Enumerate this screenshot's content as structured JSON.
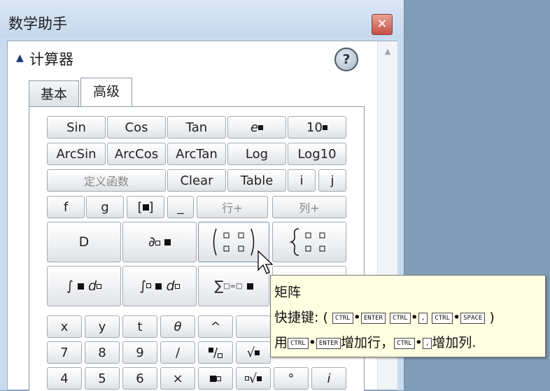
{
  "window": {
    "title": "数学助手",
    "close_glyph": "✕"
  },
  "section": {
    "title": "计算器",
    "help_label": "?"
  },
  "tabs": [
    {
      "label": "基本"
    },
    {
      "label": "高级"
    }
  ],
  "buttons": {
    "sin": "Sin",
    "cos": "Cos",
    "tan": "Tan",
    "e": "e",
    "ten": "10",
    "arcsin": "ArcSin",
    "arccos": "ArcCos",
    "arctan": "ArcTan",
    "log": "Log",
    "log10": "Log10",
    "define_function": "定义函数",
    "clear": "Clear",
    "table": "Table",
    "i": "i",
    "j": "j",
    "f": "f",
    "g": "g",
    "underscore": "_",
    "add_row": "行+",
    "add_col": "列+",
    "d": "D",
    "x": "x",
    "y": "y",
    "t": "t",
    "theta": "θ",
    "caret": "^",
    "seven": "7",
    "eight": "8",
    "nine": "9",
    "divide": "/",
    "four": "4",
    "five": "5",
    "six": "6",
    "times": "×",
    "degree": "°",
    "imag": "i"
  },
  "tooltip": {
    "title": "矩阵",
    "shortcut_label": "快捷键:",
    "open_paren": "(",
    "close_paren": ")",
    "line3_prefix": "用",
    "line3_add_row": "增加行，",
    "line3_add_col": "增加列.",
    "keys": {
      "ctrl": "CTRL",
      "enter": "ENTER",
      "space": "SPACE",
      "comma": ","
    }
  }
}
